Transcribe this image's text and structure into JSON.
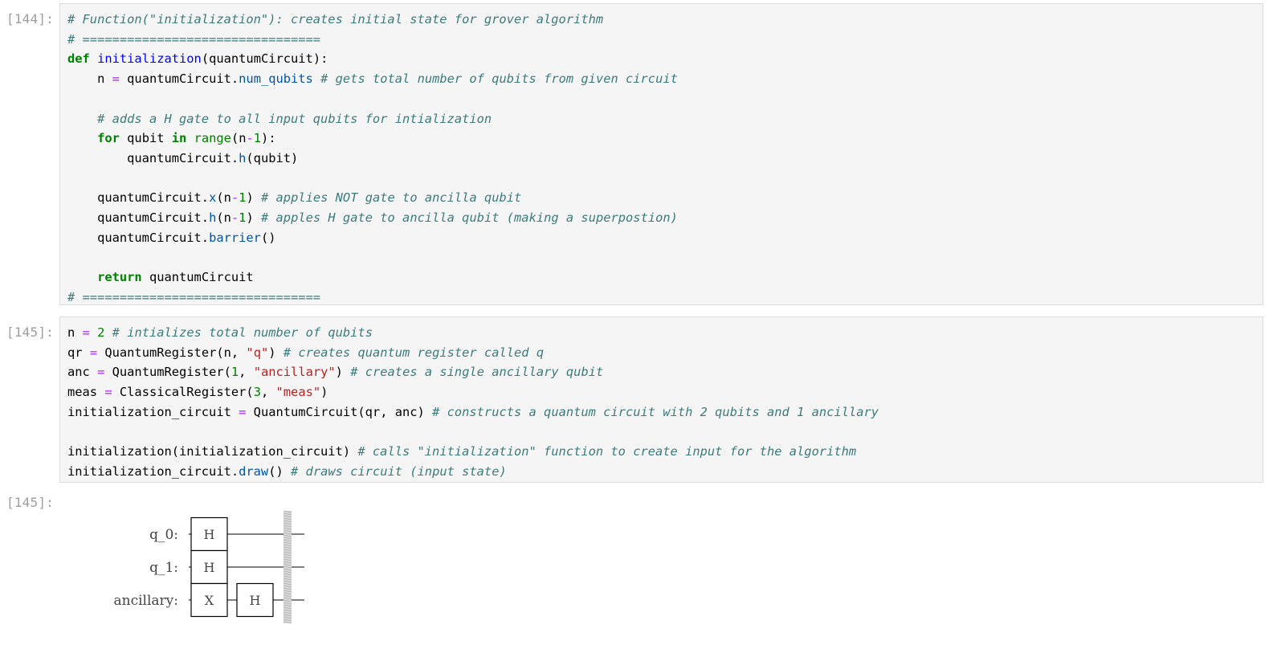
{
  "cells": [
    {
      "prompt": "[144]:",
      "lines": [
        [
          {
            "t": "cmt",
            "v": "# Function(\"initialization\"): creates initial state for grover algorithm"
          }
        ],
        [
          {
            "t": "cmt",
            "v": "# ================================"
          }
        ],
        [
          {
            "t": "kw",
            "v": "def"
          },
          {
            "t": "plain",
            "v": " "
          },
          {
            "t": "fn",
            "v": "initialization"
          },
          {
            "t": "plain",
            "v": "(quantumCircuit):"
          }
        ],
        [
          {
            "t": "plain",
            "v": "    n "
          },
          {
            "t": "op",
            "v": "="
          },
          {
            "t": "plain",
            "v": " quantumCircuit."
          },
          {
            "t": "attr",
            "v": "num_qubits"
          },
          {
            "t": "plain",
            "v": " "
          },
          {
            "t": "cmt",
            "v": "# gets total number of qubits from given circuit"
          }
        ],
        [
          {
            "t": "plain",
            "v": ""
          }
        ],
        [
          {
            "t": "plain",
            "v": "    "
          },
          {
            "t": "cmt",
            "v": "# adds a H gate to all input qubits for intialization"
          }
        ],
        [
          {
            "t": "plain",
            "v": "    "
          },
          {
            "t": "kw",
            "v": "for"
          },
          {
            "t": "plain",
            "v": " qubit "
          },
          {
            "t": "kw",
            "v": "in"
          },
          {
            "t": "plain",
            "v": " "
          },
          {
            "t": "bi",
            "v": "range"
          },
          {
            "t": "plain",
            "v": "(n"
          },
          {
            "t": "op",
            "v": "-"
          },
          {
            "t": "num",
            "v": "1"
          },
          {
            "t": "plain",
            "v": "):"
          }
        ],
        [
          {
            "t": "plain",
            "v": "        quantumCircuit."
          },
          {
            "t": "attr",
            "v": "h"
          },
          {
            "t": "plain",
            "v": "(qubit)"
          }
        ],
        [
          {
            "t": "plain",
            "v": ""
          }
        ],
        [
          {
            "t": "plain",
            "v": "    quantumCircuit."
          },
          {
            "t": "attr",
            "v": "x"
          },
          {
            "t": "plain",
            "v": "(n"
          },
          {
            "t": "op",
            "v": "-"
          },
          {
            "t": "num",
            "v": "1"
          },
          {
            "t": "plain",
            "v": ") "
          },
          {
            "t": "cmt",
            "v": "# applies NOT gate to ancilla qubit"
          }
        ],
        [
          {
            "t": "plain",
            "v": "    quantumCircuit."
          },
          {
            "t": "attr",
            "v": "h"
          },
          {
            "t": "plain",
            "v": "(n"
          },
          {
            "t": "op",
            "v": "-"
          },
          {
            "t": "num",
            "v": "1"
          },
          {
            "t": "plain",
            "v": ") "
          },
          {
            "t": "cmt",
            "v": "# apples H gate to ancilla qubit (making a superpostion)"
          }
        ],
        [
          {
            "t": "plain",
            "v": "    quantumCircuit."
          },
          {
            "t": "attr",
            "v": "barrier"
          },
          {
            "t": "plain",
            "v": "()"
          }
        ],
        [
          {
            "t": "plain",
            "v": ""
          }
        ],
        [
          {
            "t": "plain",
            "v": "    "
          },
          {
            "t": "kw",
            "v": "return"
          },
          {
            "t": "plain",
            "v": " quantumCircuit"
          }
        ],
        [
          {
            "t": "cmt",
            "v": "# ================================"
          }
        ]
      ]
    },
    {
      "prompt": "[145]:",
      "lines": [
        [
          {
            "t": "plain",
            "v": "n "
          },
          {
            "t": "op",
            "v": "="
          },
          {
            "t": "plain",
            "v": " "
          },
          {
            "t": "num",
            "v": "2"
          },
          {
            "t": "plain",
            "v": " "
          },
          {
            "t": "cmt",
            "v": "# intializes total number of qubits"
          }
        ],
        [
          {
            "t": "plain",
            "v": "qr "
          },
          {
            "t": "op",
            "v": "="
          },
          {
            "t": "plain",
            "v": " QuantumRegister(n, "
          },
          {
            "t": "str",
            "v": "\"q\""
          },
          {
            "t": "plain",
            "v": ") "
          },
          {
            "t": "cmt",
            "v": "# creates quantum register called q"
          }
        ],
        [
          {
            "t": "plain",
            "v": "anc "
          },
          {
            "t": "op",
            "v": "="
          },
          {
            "t": "plain",
            "v": " QuantumRegister("
          },
          {
            "t": "num",
            "v": "1"
          },
          {
            "t": "plain",
            "v": ", "
          },
          {
            "t": "str",
            "v": "\"ancillary\""
          },
          {
            "t": "plain",
            "v": ") "
          },
          {
            "t": "cmt",
            "v": "# creates a single ancillary qubit"
          }
        ],
        [
          {
            "t": "plain",
            "v": "meas "
          },
          {
            "t": "op",
            "v": "="
          },
          {
            "t": "plain",
            "v": " ClassicalRegister("
          },
          {
            "t": "num",
            "v": "3"
          },
          {
            "t": "plain",
            "v": ", "
          },
          {
            "t": "str",
            "v": "\"meas\""
          },
          {
            "t": "plain",
            "v": ")"
          }
        ],
        [
          {
            "t": "plain",
            "v": "initialization_circuit "
          },
          {
            "t": "op",
            "v": "="
          },
          {
            "t": "plain",
            "v": " QuantumCircuit(qr, anc) "
          },
          {
            "t": "cmt",
            "v": "# constructs a quantum circuit with 2 qubits and 1 ancillary"
          }
        ],
        [
          {
            "t": "plain",
            "v": ""
          }
        ],
        [
          {
            "t": "plain",
            "v": "initialization(initialization_circuit) "
          },
          {
            "t": "cmt",
            "v": "# calls \"initialization\" function to create input for the algorithm"
          }
        ],
        [
          {
            "t": "plain",
            "v": "initialization_circuit."
          },
          {
            "t": "attr",
            "v": "draw"
          },
          {
            "t": "plain",
            "v": "() "
          },
          {
            "t": "cmt",
            "v": "# draws circuit (input state)"
          }
        ]
      ]
    }
  ],
  "output": {
    "prompt": "[145]:",
    "circuit": {
      "wires": [
        "q_0:",
        "q_1:",
        "ancillary:"
      ],
      "gates": [
        {
          "wire": 0,
          "label": "H",
          "col": 0
        },
        {
          "wire": 1,
          "label": "H",
          "col": 0
        },
        {
          "wire": 2,
          "label": "X",
          "col": 0
        },
        {
          "wire": 2,
          "label": "H",
          "col": 1
        }
      ]
    }
  }
}
